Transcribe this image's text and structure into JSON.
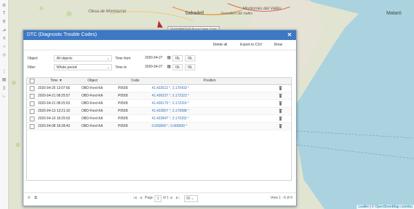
{
  "map": {
    "labels": [
      {
        "text": "Sabadell",
        "style": "big"
      },
      {
        "text": "Mataró",
        "style": "big"
      },
      {
        "text": "Olesa de Montserrat",
        "style": "normal"
      },
      {
        "text": "Montornès del Vallès",
        "style": "normal"
      },
      {
        "text": "Granollers del Vallès",
        "style": "normal"
      }
    ],
    "marker_label": "S510845680018135 ord-Fusion (0 km)",
    "attribution_leaflet": "Leaflet",
    "attribution_osm": "© OpenStreetMap contribu"
  },
  "toolbar_icons": [
    "globe-icon",
    "text-icon",
    "pin-icon",
    "ruler-icon",
    "layers-icon",
    "circle-icon",
    "polygon-icon",
    "grid-icon",
    "chart-icon",
    "bookmark-icon",
    "route-icon"
  ],
  "dialog": {
    "title": "DTC (Diagnostic Trouble Codes)",
    "close_glyph": "✕",
    "toolbar": {
      "delete_all": "Delete all",
      "export_csv": "Export to CSV",
      "show": "Show"
    },
    "filters": {
      "object_label": "Object",
      "object_value": "All objects",
      "filter_label": "Filter",
      "filter_value": "Whole period",
      "time_from_label": "Time from",
      "time_from_date": "2020-04-27",
      "time_from_hour": "00",
      "time_from_min": "00",
      "time_to_label": "Time to",
      "time_to_date": "2020-04-27",
      "time_to_hour": "00",
      "time_to_min": "00"
    },
    "grid": {
      "headers": {
        "time": "Time",
        "object": "Object",
        "code": "Code",
        "position": "Position"
      },
      "rows": [
        {
          "time": "2020-04-25 13:07:56",
          "object": "OBD-Ford-KA",
          "code": "P0505",
          "position": "41.422612 °, 2.170433 °"
        },
        {
          "time": "2020-04-21 08:25:57",
          "object": "OBD-Ford-KA",
          "code": "P0505",
          "position": "41.426237 °, 2.172323 °"
        },
        {
          "time": "2020-04-21 08:25:53",
          "object": "OBD-Ford-KA",
          "code": "P0505",
          "position": "41.426179 °, 2.172315 °"
        },
        {
          "time": "2020-04-13 13:21:10",
          "object": "OBD-Ford-KA",
          "code": "P0505",
          "position": "41.422807 °, 2.170588 °"
        },
        {
          "time": "2020-04-10 18:25:53",
          "object": "OBD-Ford-KA",
          "code": "P0505",
          "position": "41.422847 °, 2.170202 °"
        },
        {
          "time": "2020-04-08 18:28:43",
          "object": "OBD-Ford-KA",
          "code": "P0505",
          "position": "0.000000 °, 0.000000 °"
        }
      ]
    },
    "pager": {
      "page_label": "Page",
      "page_value": "1",
      "of_label": "of 1",
      "page_size": "50",
      "view_text": "View 1 - 6 of 6"
    }
  }
}
